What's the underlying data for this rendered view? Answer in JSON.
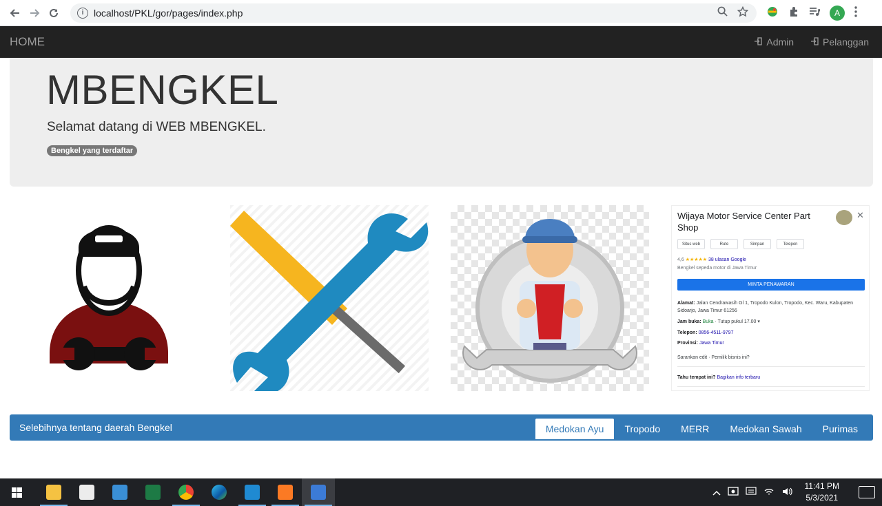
{
  "browser": {
    "url": "localhost/PKL/gor/pages/index.php",
    "profile_initial": "A"
  },
  "navbar": {
    "brand": "HOME",
    "links": [
      {
        "label": "Admin"
      },
      {
        "label": "Pelanggan"
      }
    ]
  },
  "jumbotron": {
    "title": "MBENGKEL",
    "subtitle": "Selamat datang di WEB MBENGKEL.",
    "badge": "Bengkel yang terdaftar"
  },
  "business_card": {
    "name": "Wijaya Motor Service Center Part Shop",
    "actions": [
      "Situs web",
      "Rute",
      "Simpan",
      "Telepon"
    ],
    "rating": "4,6",
    "stars": "★★★★★",
    "reviews": "38 ulasan Google",
    "category": "Bengkel sepeda motor di Jawa Timur",
    "cta": "MINTA PENAWARAN",
    "address_label": "Alamat:",
    "address": "Jalan Cendrawasih Gl 1, Tropodo Kulon, Tropodo, Kec. Waru, Kabupaten Sidoarjo, Jawa Timur 61256",
    "hours_label": "Jam buka:",
    "hours_open": "Buka",
    "hours_rest": "· Tutup pukul 17.00 ▾",
    "phone_label": "Telepon:",
    "phone": "0856-4511-9797",
    "province_label": "Provinsi:",
    "province": "Jawa Timur",
    "suggest": "Sarankan edit · Pemilik bisnis ini?",
    "know_label": "Tahu tempat ini?",
    "know_link": "Bagikan info terbaru"
  },
  "panel": {
    "title": "Selebihnya tentang daerah Bengkel",
    "tabs": [
      {
        "label": "Medokan Ayu",
        "active": true
      },
      {
        "label": "Tropodo",
        "active": false
      },
      {
        "label": "MERR",
        "active": false
      },
      {
        "label": "Medokan Sawah",
        "active": false
      },
      {
        "label": "Purimas",
        "active": false
      }
    ]
  },
  "taskbar": {
    "time": "11:41 PM",
    "date": "5/3/2021"
  },
  "colors": {
    "navbar_bg": "#222222",
    "jumbotron_bg": "#eeeeee",
    "panel_bg": "#337ab7",
    "badge_bg": "#777777"
  }
}
